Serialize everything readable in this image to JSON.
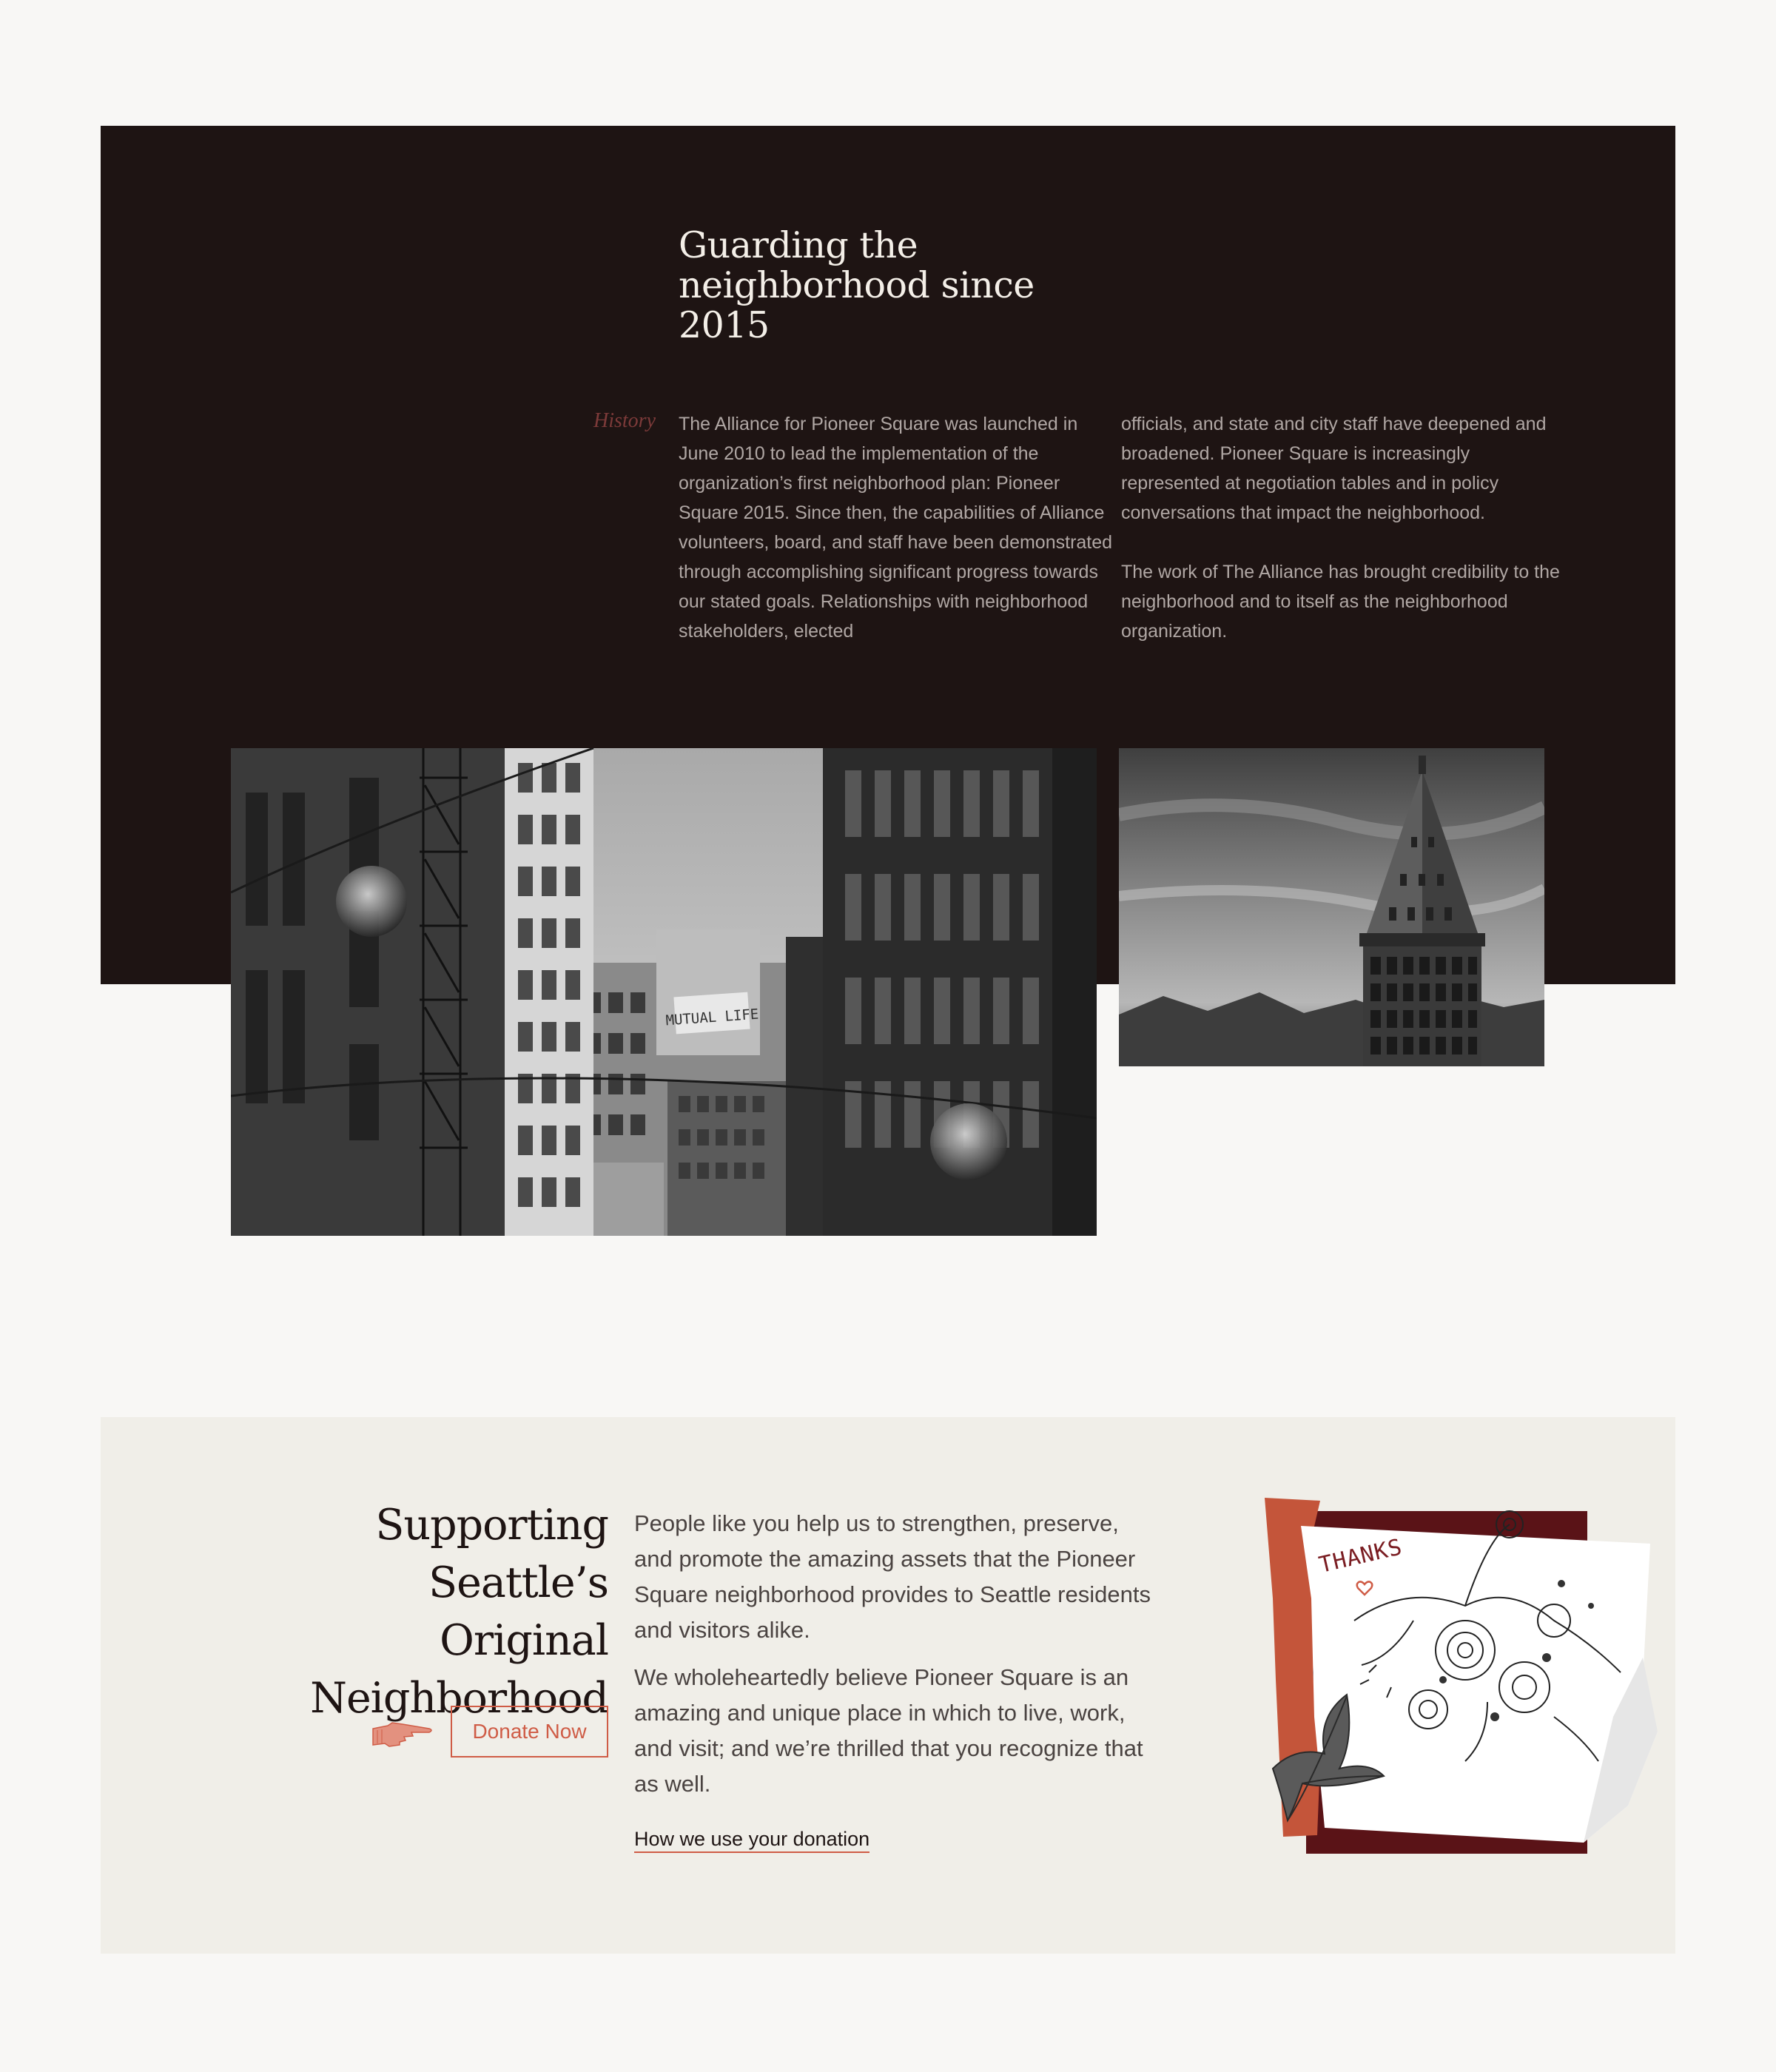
{
  "history": {
    "title": "Guarding the neighborhood since 2015",
    "label": "History",
    "column_1": "The Alliance for Pioneer Square was launched in June 2010 to lead the implementation of the organization’s first neighborhood plan: Pioneer Square 2015. Since then, the capabilities of Alliance volunteers, board, and staff have been demonstrated through accomplishing significant progress towards our stated goals. Relationships with neighborhood stakeholders, elected",
    "column_2_p1": "officials, and state and city staff have deepened and broadened. Pioneer Square is increasingly represented at negotiation tables and in policy conversations that impact the neighborhood.",
    "column_2_p2": "The work of The Alliance has brought credibility to the neighborhood and to itself as the neighborhood organization.",
    "photos": {
      "street_sign": "MUTUAL LIFE"
    }
  },
  "support": {
    "title": "Supporting Seattle’s Original Neighborhood",
    "donate_label": "Donate Now",
    "paragraph_1": "People like you help us to strengthen, preserve, and promote the amazing assets that the Pioneer Square neighborhood provides to Seattle residents and visitors alike.",
    "paragraph_2": "We wholeheartedly believe Pioneer Square is an amazing and unique place in which to live, work, and visit; and we’re thrilled that you recognize that as well.",
    "link_label": "How we use your donation",
    "collage_note": "THANKS"
  },
  "colors": {
    "dark_panel": "#1e1413",
    "accent": "#cf5c46",
    "label_maroon": "#7c3a39",
    "light_panel": "#f0eee8",
    "page_background": "#f8f7f5"
  },
  "icons": {
    "pointer": "pointing-hand-icon",
    "heart": "heart-icon"
  }
}
